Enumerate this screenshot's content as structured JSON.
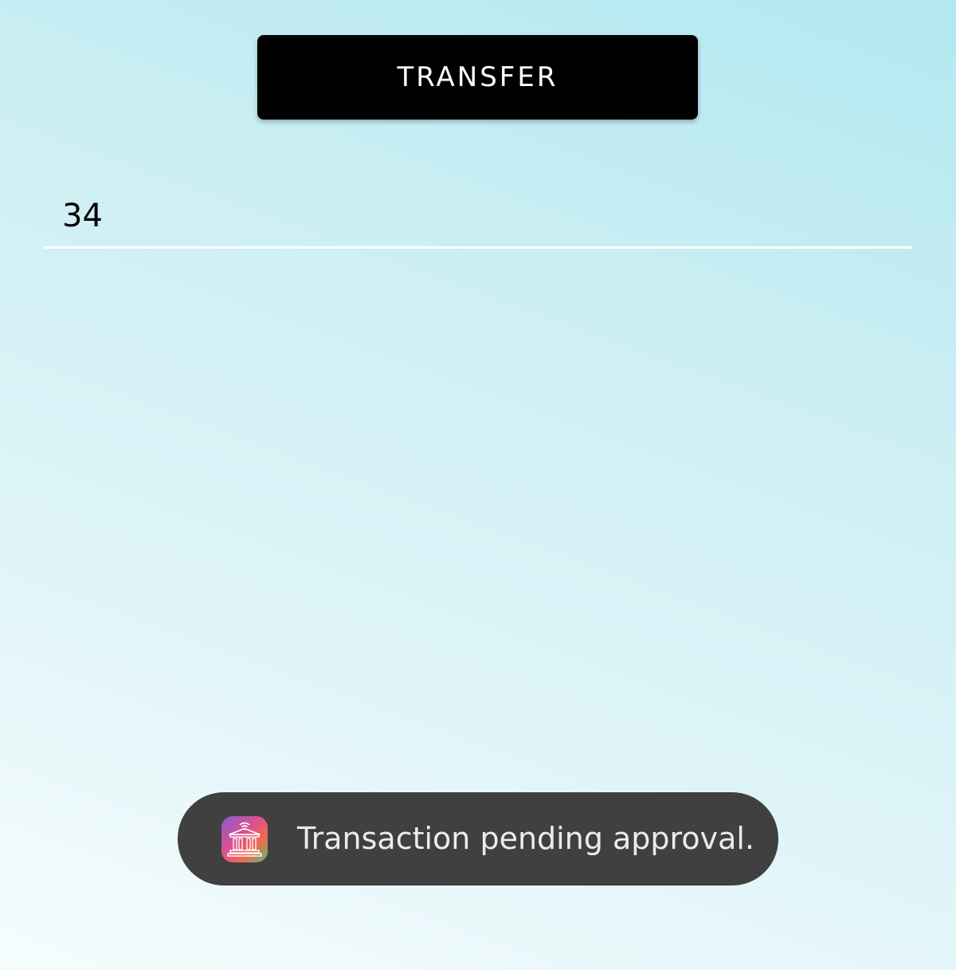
{
  "transfer_button": {
    "label": "TRANSFER"
  },
  "amount_field": {
    "value": "34"
  },
  "toast": {
    "icon": "bank-app-icon",
    "message": "Transaction pending approval."
  },
  "colors": {
    "button_background": "#000000",
    "button_text": "#ffffff",
    "toast_background": "#404040",
    "toast_text": "#ececec",
    "underline": "#ffffff"
  }
}
